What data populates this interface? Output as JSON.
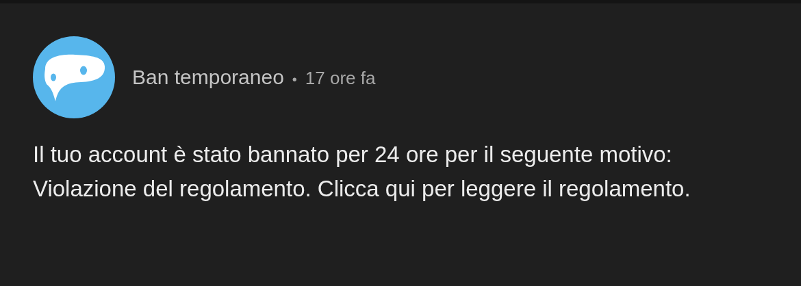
{
  "notification": {
    "title": "Ban temporaneo",
    "separator": "•",
    "time": "17 ore fa",
    "message": "Il tuo account è stato bannato per 24 ore per il seguente motivo: Violazione del regolamento. Clicca qui per leggere il regolamento."
  }
}
